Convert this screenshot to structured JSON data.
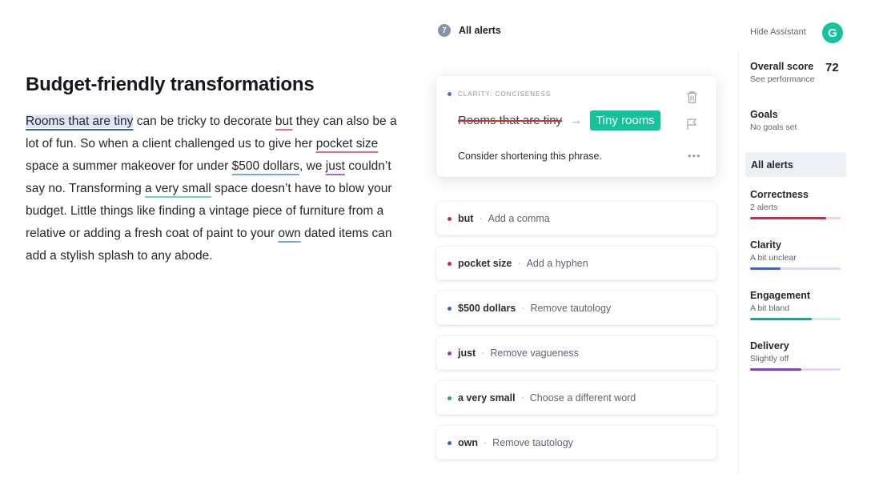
{
  "document": {
    "title": "Budget-friendly transformations",
    "body": [
      {
        "t": "Rooms that are tiny",
        "hl": "blue active"
      },
      {
        "t": " can be tricky to decorate "
      },
      {
        "t": "but",
        "hl": "red"
      },
      {
        "t": " they can also be a lot of fun.  So when a client challenged us to give her "
      },
      {
        "t": "pocket size",
        "hl": "red"
      },
      {
        "t": " space a summer makeover for under "
      },
      {
        "t": "$500 dollars",
        "hl": "blue-lt"
      },
      {
        "t": ", we "
      },
      {
        "t": "just",
        "hl": "purple"
      },
      {
        "t": " couldn’t say no. Transforming "
      },
      {
        "t": "a very small",
        "hl": "green"
      },
      {
        "t": " space doesn’t have to blow your budget. Little things like finding a vintage piece of furniture from a relative or adding a fresh coat of paint to your "
      },
      {
        "t": "own",
        "hl": "blue-lt"
      },
      {
        "t": " dated items can add a stylish splash to any abode."
      }
    ]
  },
  "alerts_header": {
    "count": "7",
    "title": "All alerts"
  },
  "expanded_card": {
    "category": "CLARITY: CONCISENESS",
    "original": "Rooms that are tiny",
    "replacement": "Tiny rooms",
    "explanation": "Consider shortening this phrase.",
    "dot_color": "#4a6fd1",
    "icons": [
      "trash-icon",
      "flag-icon",
      "more-icon"
    ]
  },
  "alert_items": [
    {
      "word": "but",
      "desc": "Add a comma",
      "color": "#d1293d"
    },
    {
      "word": "pocket size",
      "desc": "Add a hyphen",
      "color": "#d1293d"
    },
    {
      "word": "$500 dollars",
      "desc": "Remove tautology",
      "color": "#3f62c6"
    },
    {
      "word": "just",
      "desc": "Remove vagueness",
      "color": "#8b3fc0"
    },
    {
      "word": "a very small",
      "desc": "Choose a different word",
      "color": "#15a98a"
    },
    {
      "word": "own",
      "desc": "Remove tautology",
      "color": "#3f62c6"
    }
  ],
  "sidebar": {
    "hide_assistant": "Hide Assistant",
    "logo_letter": "G",
    "overall_score_label": "Overall score",
    "overall_score_value": "72",
    "see_performance": "See performance",
    "goals_label": "Goals",
    "goals_sub": "No goals set",
    "all_alerts": "All alerts",
    "categories": [
      {
        "label": "Correctness",
        "sub": "2 alerts",
        "fill": 0.84,
        "color": "#d1293d",
        "track": "#f6d3d8"
      },
      {
        "label": "Clarity",
        "sub": "A bit unclear",
        "fill": 0.34,
        "color": "#3f62c6",
        "track": "#d6e0f5"
      },
      {
        "label": "Engagement",
        "sub": "A bit bland",
        "fill": 0.68,
        "color": "#15a98a",
        "track": "#cdeee5"
      },
      {
        "label": "Delivery",
        "sub": "Slightly off",
        "fill": 0.57,
        "color": "#8b3fc0",
        "track": "#e6d6f2"
      }
    ]
  }
}
